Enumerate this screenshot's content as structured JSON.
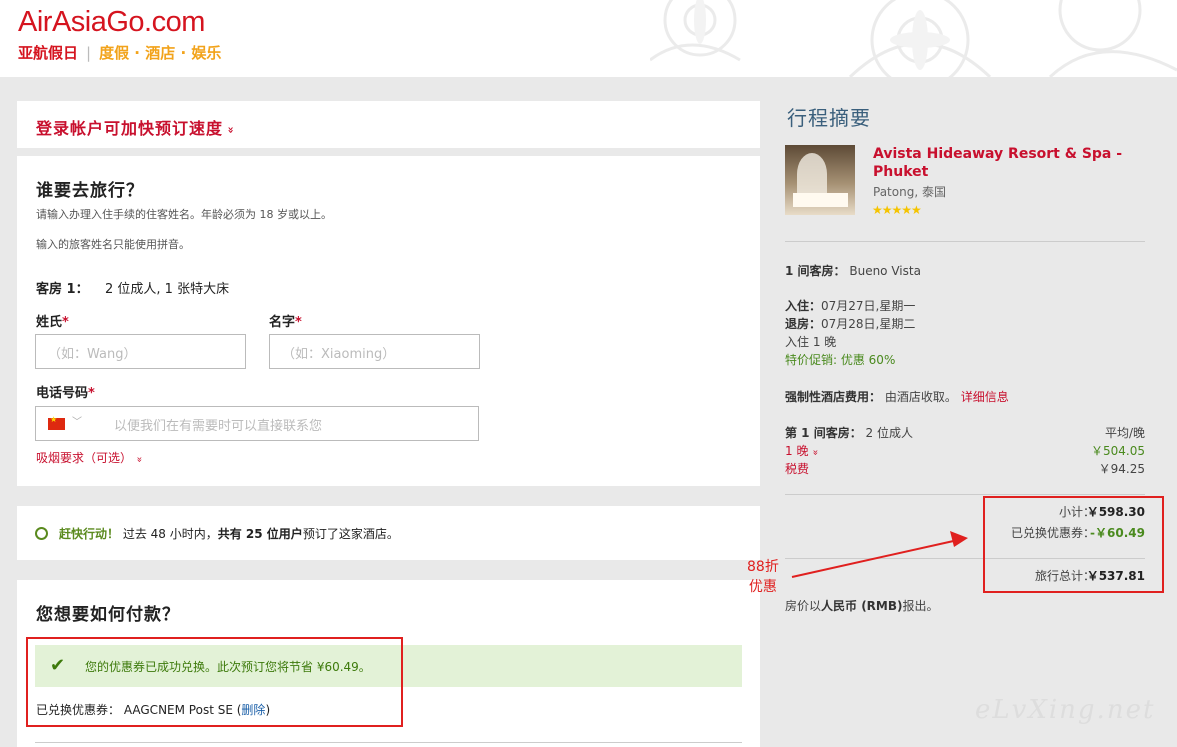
{
  "header": {
    "logo_main": "AirAsiaGo.com",
    "logo_cn": "亚航假日",
    "logo_sep": "|",
    "logo_tagline": "度假 · 酒店 · 娱乐"
  },
  "login": {
    "text": "登录帐户可加快预订速度",
    "chevron": "»"
  },
  "guest": {
    "title": "谁要去旅行？",
    "note1": "请输入办理入住手续的住客姓名。年龄必须为 18 岁或以上。",
    "note2": "输入的旅客姓名只能使用拼音。",
    "room_label": "客房 1：",
    "room_desc": "2 位成人, 1 张特大床",
    "last_name_label": "姓氏",
    "first_name_label": "名字",
    "required_mark": "*",
    "last_name_placeholder": "（如：Wang）",
    "first_name_placeholder": "（如：Xiaoming）",
    "phone_label": "电话号码",
    "phone_placeholder": "以便我们在有需要时可以直接联系您",
    "phone_country": "China",
    "smoking": "吸烟要求（可选）"
  },
  "hurry": {
    "lead": "赶快行动！",
    "text_a": "过去 48 小时内，",
    "text_b": "共有 25 位用户",
    "text_c": "预订了这家酒店。"
  },
  "payment": {
    "title": "您想要如何付款？",
    "success": "您的优惠券已成功兑换。此次预订您将节省 ¥60.49。",
    "voucher_label": "已兑换优惠券：",
    "voucher_code": "AAGCNEM Post SE",
    "remove_link": "删除"
  },
  "summary": {
    "title": "行程摘要",
    "hotel_name": "Avista Hideaway Resort & Spa - Phuket",
    "location": "Patong, 泰国",
    "stars": "★★★★★",
    "room_label": "1 间客房：",
    "room_name": "Bueno Vista",
    "checkin_label": "入住：",
    "checkin": "07月27日,星期一",
    "checkout_label": "退房：",
    "checkout": "07月28日,星期二",
    "nights": "入住 1 晚",
    "promo": "特价促销: 优惠 60%",
    "fee_label": "强制性酒店费用：",
    "fee_text": "由酒店收取。",
    "fee_link": "详细信息",
    "room1_label": "第 1 间客房：",
    "room1_desc": "2 位成人",
    "avg_label": "平均/晚",
    "night_label": "1 晚",
    "night_price": "￥504.05",
    "tax_label": "税费",
    "tax_price": "￥94.25",
    "subtotal_label": "小计：",
    "subtotal": "￥598.30",
    "coupon_label": "已兑换优惠券：",
    "coupon": "-￥60.49",
    "total_label": "旅行总计：",
    "total": "￥537.81",
    "currency_note_a": "房价以",
    "currency_note_b": "人民币 (RMB)",
    "currency_note_c": "报出。"
  },
  "annotation": {
    "line1": "88折",
    "line2": "优惠"
  },
  "watermark": "eLvXing.net",
  "colors": {
    "brand_red": "#d5141f",
    "link_red": "#c8102e",
    "green": "#4a8a1e",
    "annotation_red": "#e0201f"
  }
}
